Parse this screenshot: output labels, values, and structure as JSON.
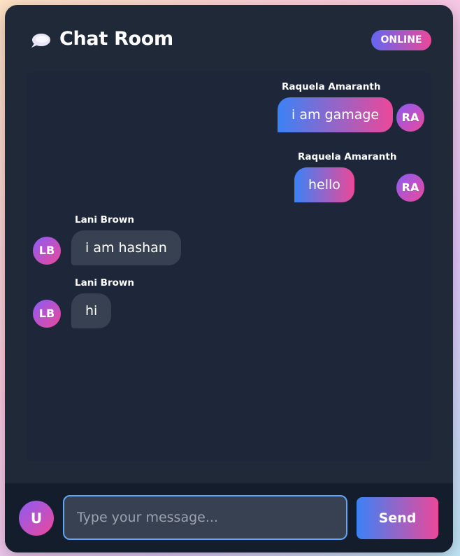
{
  "header": {
    "title": "Chat Room",
    "status": "ONLINE",
    "icon": "speech-bubble-icon"
  },
  "messages": [
    {
      "sender": "Raquela Amaranth",
      "initials": "RA",
      "text": "i am gamage",
      "direction": "outgoing"
    },
    {
      "sender": "Raquela Amaranth",
      "initials": "RA",
      "text": "hello",
      "direction": "outgoing"
    },
    {
      "sender": "Lani Brown",
      "initials": "LB",
      "text": "i am hashan",
      "direction": "incoming"
    },
    {
      "sender": "Lani Brown",
      "initials": "LB",
      "text": "hi",
      "direction": "incoming"
    }
  ],
  "composer": {
    "user_initial": "U",
    "placeholder": "Type your message...",
    "value": "",
    "send_label": "Send"
  },
  "colors": {
    "panel": "#1f2937",
    "accent_start": "#3b82f6",
    "accent_end": "#ec4899",
    "incoming_bubble": "#374151"
  }
}
